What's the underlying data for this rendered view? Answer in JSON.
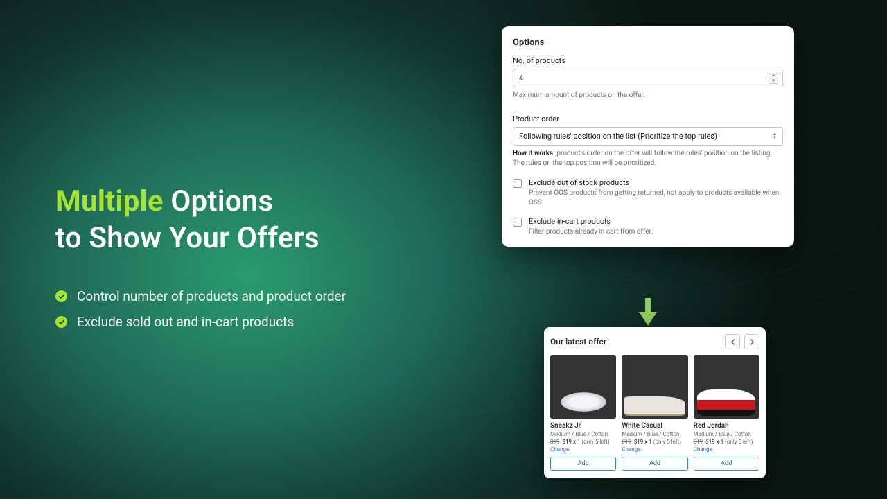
{
  "headline": {
    "accent": "Multiple",
    "rest1": " Options",
    "line2": "to Show Your Offers"
  },
  "bullets": [
    "Control number of products and product order",
    "Exclude sold out and in-cart products"
  ],
  "options": {
    "title": "Options",
    "numLabel": "No. of products",
    "numValue": "4",
    "numHelper": "Maximum amount of products on the offer.",
    "orderLabel": "Product order",
    "orderValue": "Following rules' position on the list (Prioritize the top rules)",
    "howLabel": "How it works:",
    "howText": " product's order on the offer will follow the rules' position on the listing. The rules on the top position will be prioritized.",
    "check1": {
      "label": "Exclude out of stock products",
      "helper": "Prevent OOS products from getting returned, not apply to products available when OSS."
    },
    "check2": {
      "label": "Exclude in-cart products",
      "helper": "Filter products already in cart from offer."
    }
  },
  "offer": {
    "title": "Our latest offer",
    "products": [
      {
        "name": "Sneakz Jr",
        "variant": "Medium / Blue / Cotton",
        "strike": "$19",
        "price": "$19",
        "qty": "x 1",
        "stock": "(only 5 left)",
        "change": "Change",
        "add": "Add"
      },
      {
        "name": "White Casual",
        "variant": "Medium / Blue / Cotton",
        "strike": "$19",
        "price": "$19",
        "qty": "x 1",
        "stock": "(only 5 left)",
        "change": "Change",
        "add": "Add"
      },
      {
        "name": "Red Jordan",
        "variant": "Medium / Blue / Cotton",
        "strike": "$19",
        "price": "$19",
        "qty": "x 1",
        "stock": "(only 5 left)",
        "change": "Change",
        "add": "Add"
      }
    ]
  }
}
